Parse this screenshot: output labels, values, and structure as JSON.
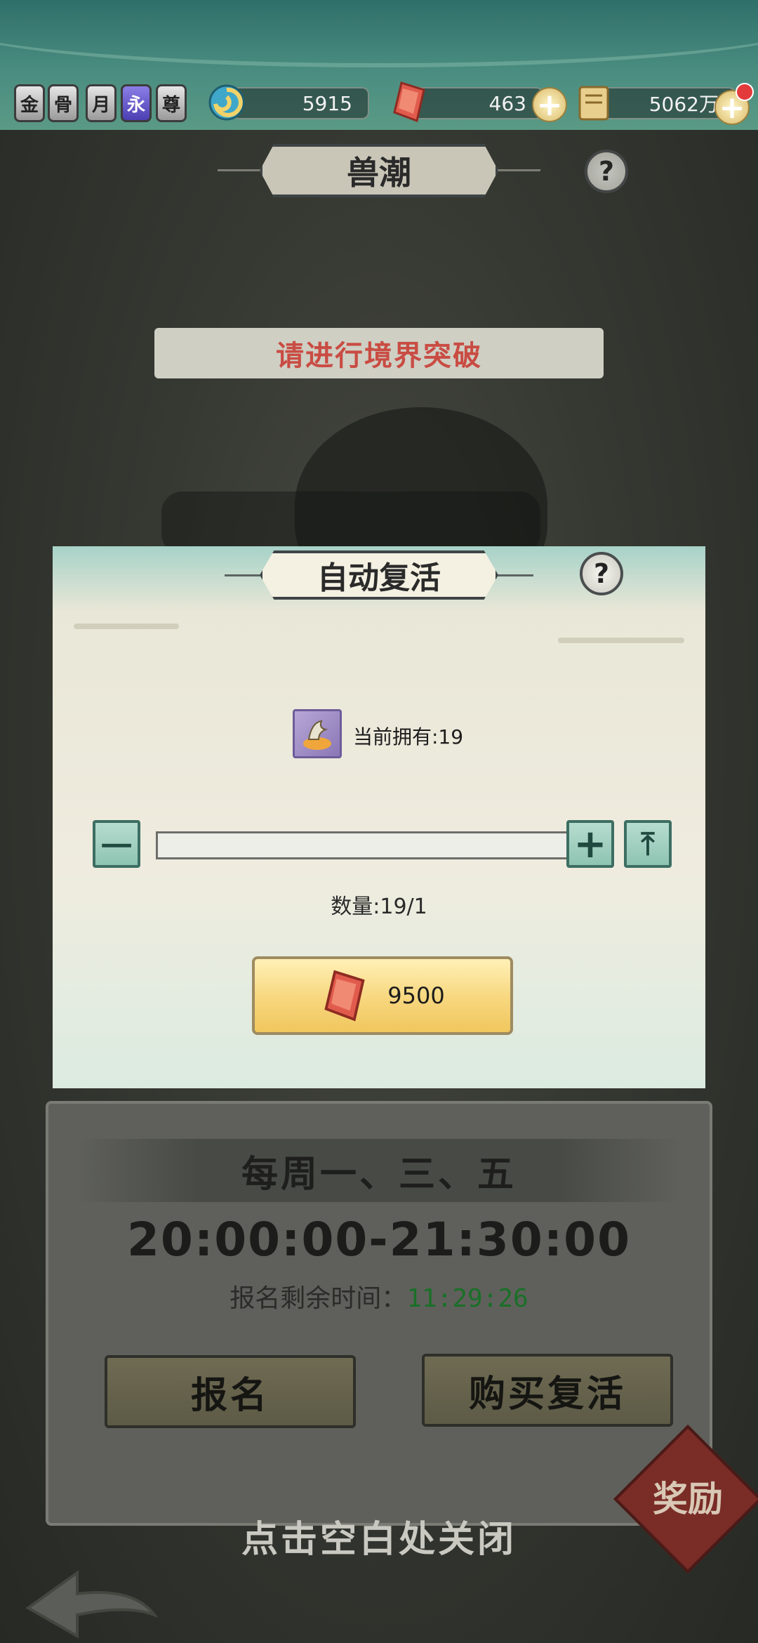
{
  "top_bar": {
    "badges": [
      "金",
      "骨",
      "月",
      "永",
      "尊"
    ],
    "resources": [
      {
        "icon": "spiral-token-icon",
        "value": "5915"
      },
      {
        "icon": "red-gem-icon",
        "value": "463"
      },
      {
        "icon": "scroll-icon",
        "value": "5062万"
      }
    ]
  },
  "page": {
    "title": "兽潮",
    "help": "?",
    "notice": "请进行境界突破"
  },
  "schedule": {
    "days": "每周一、三、五",
    "time": "20:00:00-21:30:00",
    "signup_prefix": "报名剩余时间：",
    "signup_remaining": "11:29:26",
    "signup_button": "报名",
    "buy_revive_button": "购买复活",
    "reward_label": "奖励"
  },
  "modal": {
    "title": "自动复活",
    "help": "?",
    "owned_label": "当前拥有:19",
    "minus": "一",
    "plus": "+",
    "max": "⤒",
    "quantity_label": "数量:19/1",
    "cost_value": "9500",
    "cost_icon": "red-gem-icon"
  },
  "close_hint": "点击空白处关闭",
  "colors": {
    "notice_red": "#c94c43",
    "timer_green": "#1a6f28",
    "gold_button": "#f7d67d",
    "teal_button": "#8fc4b2"
  }
}
